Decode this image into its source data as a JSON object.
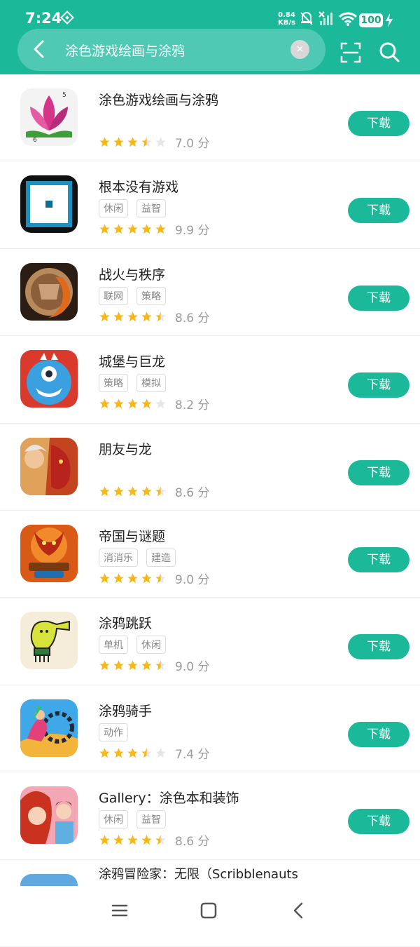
{
  "status": {
    "time": "7:24",
    "speed_value": "0.84",
    "speed_unit": "KB/s",
    "battery": "100"
  },
  "search": {
    "query": "涂色游戏绘画与涂鸦",
    "clear_label": "×"
  },
  "download_label": "下载",
  "icons": {
    "back": "back-arrow-icon",
    "scan": "scan-icon",
    "search": "search-icon",
    "nav_menu": "menu-icon",
    "nav_home": "home-icon",
    "nav_back": "back-icon"
  },
  "colors": {
    "accent": "#1bb89a",
    "star": "#f5b81a"
  },
  "apps": [
    {
      "name": "涂色游戏绘画与涂鸦",
      "tags": [],
      "rating": 3.5,
      "score": "7.0 分"
    },
    {
      "name": "根本没有游戏",
      "tags": [
        "休闲",
        "益智"
      ],
      "rating": 5,
      "score": "9.9 分"
    },
    {
      "name": "战火与秩序",
      "tags": [
        "联网",
        "策略"
      ],
      "rating": 4.5,
      "score": "8.6 分"
    },
    {
      "name": "城堡与巨龙",
      "tags": [
        "策略",
        "模拟"
      ],
      "rating": 4,
      "score": "8.2 分"
    },
    {
      "name": "朋友与龙",
      "tags": [],
      "rating": 4.5,
      "score": "8.6 分"
    },
    {
      "name": "帝国与谜题",
      "tags": [
        "消消乐",
        "建造"
      ],
      "rating": 4.5,
      "score": "9.0 分"
    },
    {
      "name": "涂鸦跳跃",
      "tags": [
        "单机",
        "休闲"
      ],
      "rating": 4.5,
      "score": "9.0 分"
    },
    {
      "name": "涂鸦骑手",
      "tags": [
        "动作"
      ],
      "rating": 3.5,
      "score": "7.4 分"
    },
    {
      "name": "Gallery：涂色本和装饰",
      "tags": [
        "休闲",
        "益智"
      ],
      "rating": 4.5,
      "score": "8.6 分"
    },
    {
      "name": "涂鸦冒险家：无限（Scribblenauts",
      "tags": [],
      "rating": null,
      "score": ""
    }
  ]
}
